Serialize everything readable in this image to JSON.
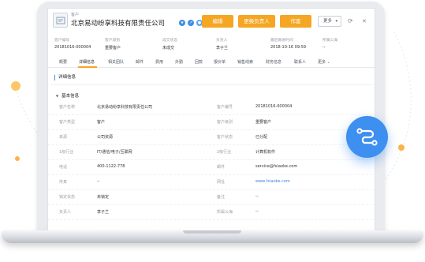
{
  "header": {
    "type_label": "客户",
    "company_name": "北京易动纷享科技有限责任公司",
    "edit_label": "编辑",
    "change_owner_label": "更换负责人",
    "void_label": "作废",
    "more_label": "更多"
  },
  "summary": [
    {
      "key": "客户编号",
      "value": "20181016-000004"
    },
    {
      "key": "客户级别",
      "value": "重要客户"
    },
    {
      "key": "成交状态",
      "value": "未成交"
    },
    {
      "key": "负责人",
      "value": "李子兰"
    },
    {
      "key": "最后跟进时间",
      "value": "2018-10-16 09:59"
    },
    {
      "key": "所属公海",
      "value": "--"
    }
  ],
  "tabs": [
    "概要",
    "详细信息",
    "相关团队",
    "邮件",
    "费用",
    "外勤",
    "回款",
    "报价单",
    "销售线索",
    "财务信息",
    "联系人",
    "更多"
  ],
  "detail_title": "详细信息",
  "section_title": "基本信息",
  "fields": [
    {
      "k1": "客户名称",
      "v1": "北京易动纷享科技有限责任公司",
      "k2": "客户编号",
      "v2": "20181016-000004"
    },
    {
      "k1": "客户类型",
      "v1": "客户",
      "k2": "客户级别",
      "v2": "重要客户"
    },
    {
      "k1": "来源",
      "v1": "公司资源",
      "k2": "客户状态",
      "v2": "已分配"
    },
    {
      "k1": "1级行业",
      "v1": "IT/通信/电子/互联网",
      "k2": "2级行业",
      "v2": "计算机软件"
    },
    {
      "k1": "电话",
      "v1": "400-1122-778",
      "k2": "邮件",
      "v2": "service@fxiaoke.com"
    },
    {
      "k1": "传真",
      "v1": "--",
      "k2": "网址",
      "v2": "www.fxiaoke.com"
    },
    {
      "k1": "锁定状态",
      "v1": "未锁定",
      "k2": "备注",
      "v2": "--"
    },
    {
      "k1": "负责人",
      "v1": "李子兰",
      "k2": "所属公海",
      "v2": "--"
    },
    {
      "k1": "",
      "v1": "",
      "k2": "",
      "v2": ""
    }
  ],
  "colors": {
    "accent_orange": "#f5a623",
    "link_blue": "#3a86d8",
    "fab_blue": "#3d8ff0"
  }
}
